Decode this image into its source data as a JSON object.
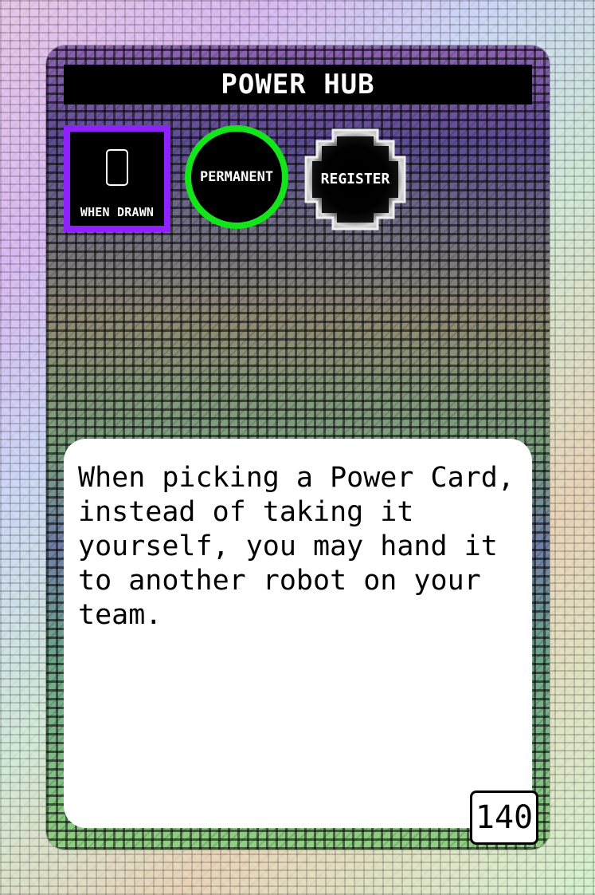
{
  "card": {
    "title": "POWER HUB",
    "icons": {
      "when_drawn": "WHEN DRAWN",
      "permanent": "PERMANENT",
      "register": "REGISTER"
    },
    "rules_text": "When picking a Power Card, instead of taking it yourself, you may hand it to another robot on your team.",
    "number": "140"
  },
  "colors": {
    "title_bar": "#000000",
    "when_drawn_border": "#8f20ff",
    "permanent_border": "#13e51a",
    "text_panel": "#ffffff"
  },
  "icon_names": {
    "when_drawn": "card-icon",
    "register": "register-octagon-icon"
  }
}
